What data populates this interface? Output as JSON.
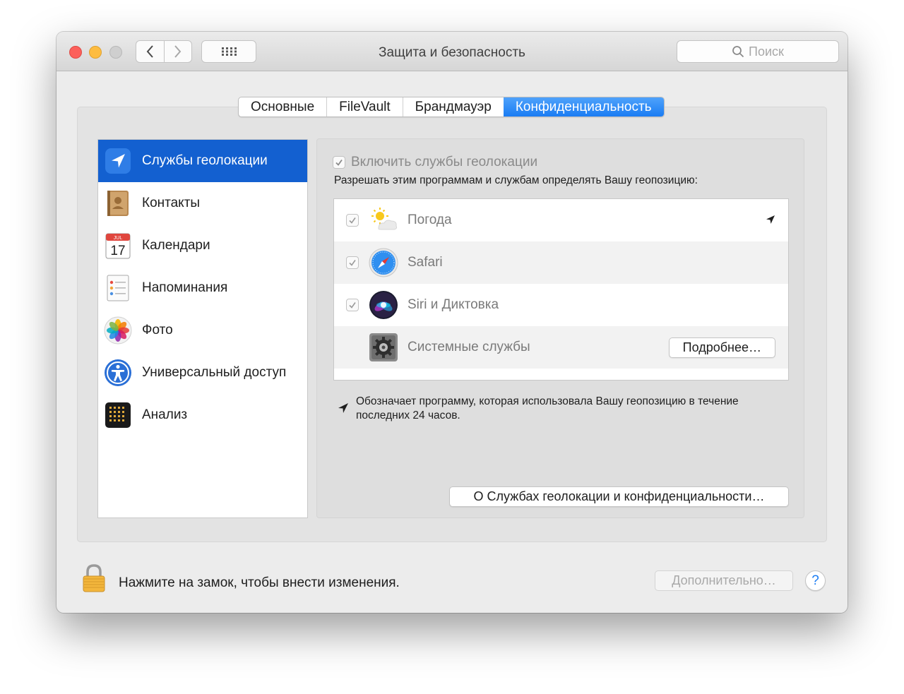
{
  "window": {
    "title": "Защита и безопасность",
    "search_placeholder": "Поиск"
  },
  "tabs": [
    {
      "label": "Основные",
      "active": false
    },
    {
      "label": "FileVault",
      "active": false
    },
    {
      "label": "Брандмауэр",
      "active": false
    },
    {
      "label": "Конфиденциальность",
      "active": true
    }
  ],
  "sidebar": {
    "items": [
      {
        "label": "Службы геолокации",
        "icon": "location-arrow-icon",
        "selected": true
      },
      {
        "label": "Контакты",
        "icon": "contacts-book-icon"
      },
      {
        "label": "Календари",
        "icon": "calendar-icon",
        "icon_month": "JUL",
        "icon_day": "17"
      },
      {
        "label": "Напоминания",
        "icon": "reminders-icon"
      },
      {
        "label": "Фото",
        "icon": "photos-flower-icon"
      },
      {
        "label": "Универсальный доступ",
        "icon": "accessibility-icon"
      },
      {
        "label": "Анализ",
        "icon": "analytics-icon"
      }
    ]
  },
  "location": {
    "enable_label": "Включить службы геолокации",
    "enabled": true,
    "description": "Разрешать этим программам и службам определять Вашу геопозицию:",
    "apps": [
      {
        "name": "Погода",
        "icon": "weather-icon",
        "checked": true,
        "recent_use": true
      },
      {
        "name": "Safari",
        "icon": "safari-compass-icon",
        "checked": true
      },
      {
        "name": "Siri и Диктовка",
        "icon": "siri-icon",
        "checked": true
      },
      {
        "name": "Системные службы",
        "icon": "system-gear-icon",
        "button": "Подробнее…"
      }
    ],
    "legend": "Обозначает программу, которая использовала Вашу геопозицию в течение последних 24 часов.",
    "about_button": "О Службах геолокации и конфиденциальности…"
  },
  "footer": {
    "lock_text": "Нажмите на замок, чтобы внести изменения.",
    "advanced_button": "Дополнительно…",
    "help_button": "?"
  },
  "colors": {
    "accent": "#1a7cf3",
    "sidebar_selected": "#1360d0",
    "close": "#fc605b",
    "minimize": "#fdbc40"
  }
}
